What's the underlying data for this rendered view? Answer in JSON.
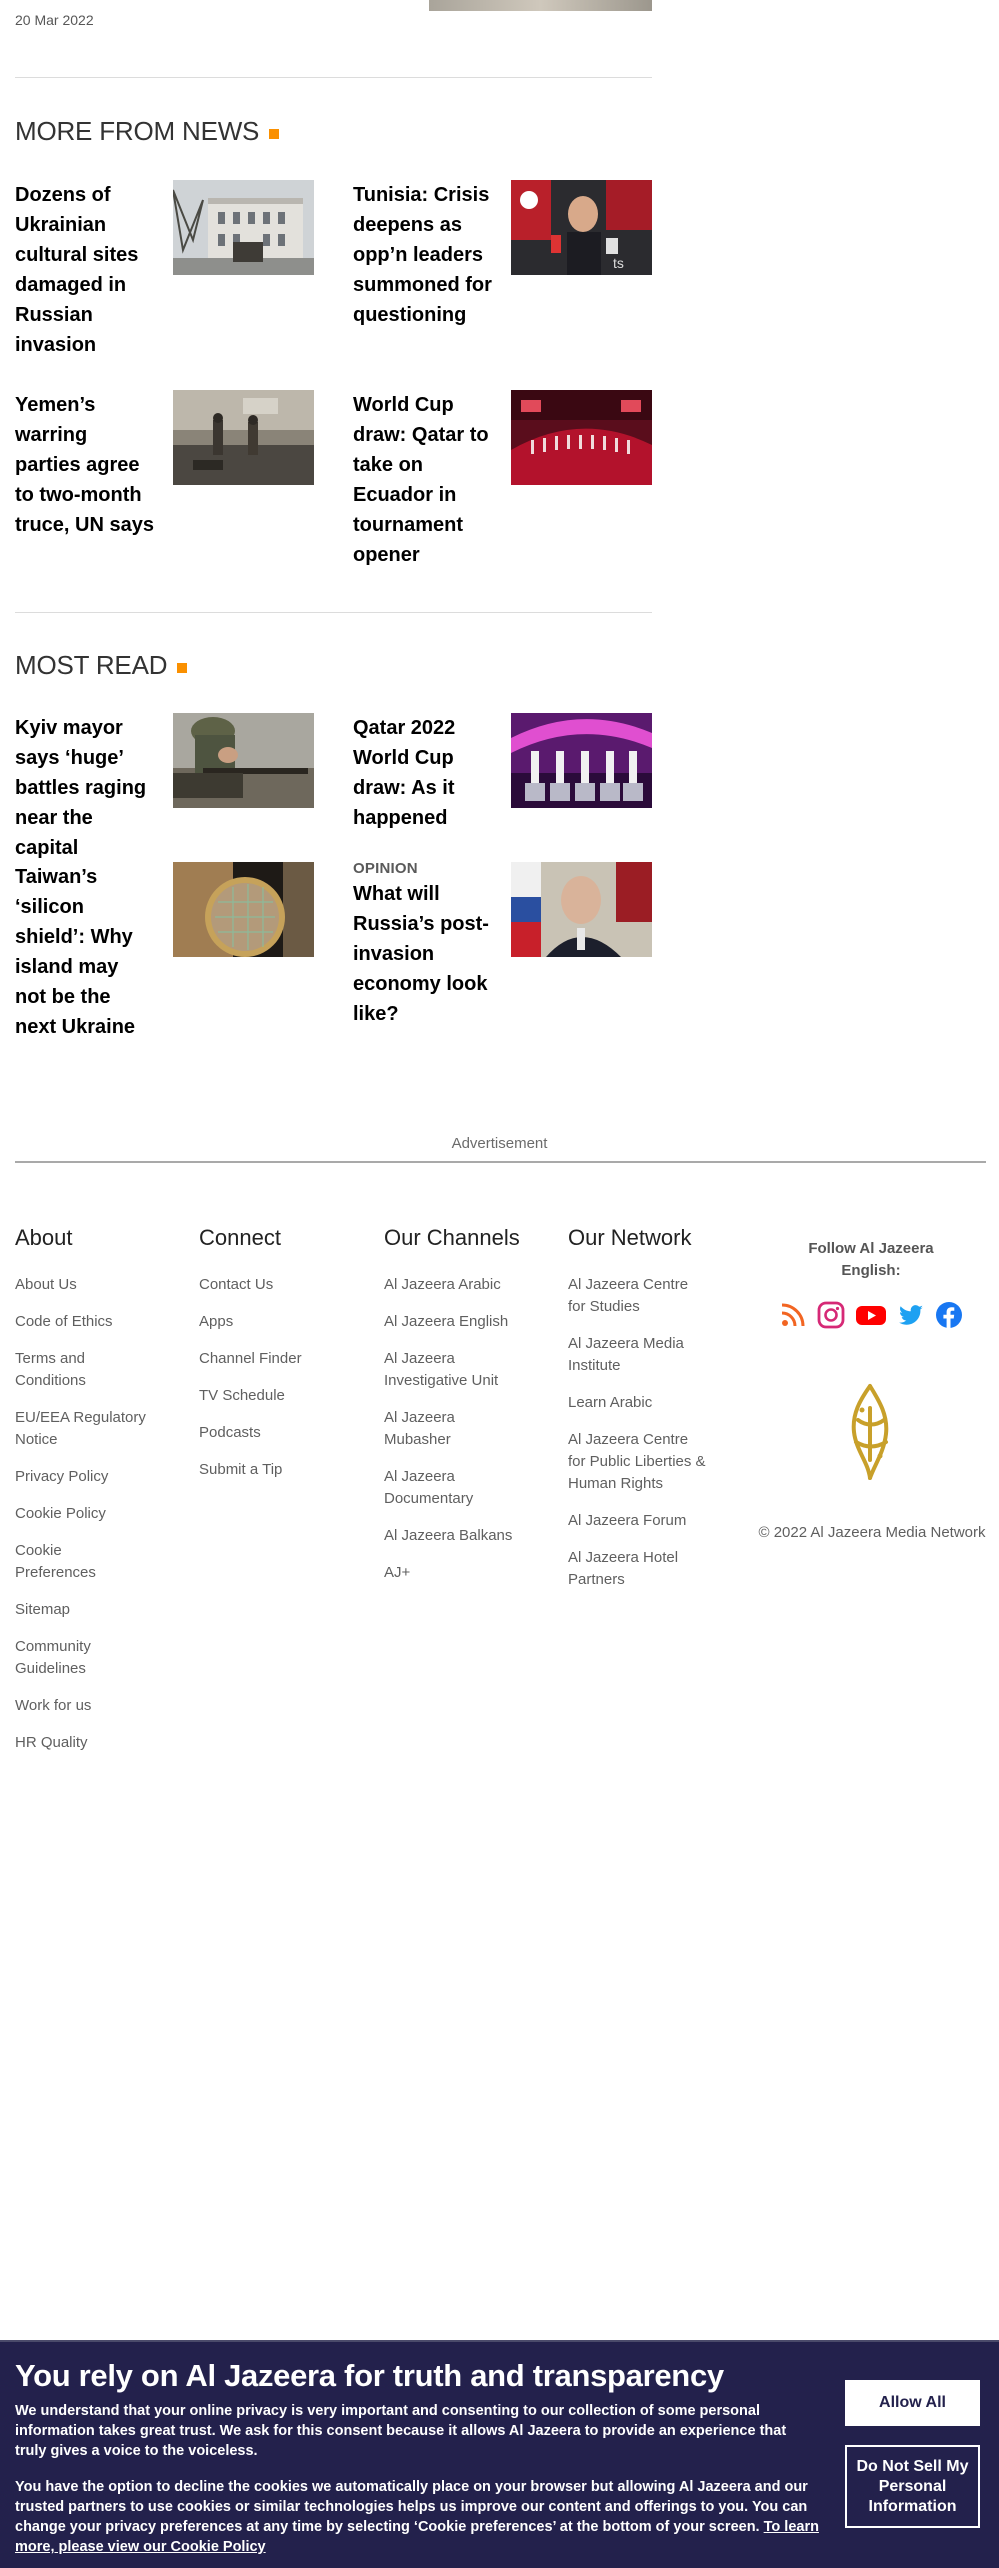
{
  "top": {
    "date": "20 Mar 2022"
  },
  "more_from_news": {
    "title": "MORE FROM NEWS",
    "items": [
      {
        "title": "Dozens of Ukrainian cultural sites damaged in Russian invasion"
      },
      {
        "title": "Tunisia: Crisis deepens as opp’n leaders summoned for questioning"
      },
      {
        "title": "Yemen’s warring parties agree to two-month truce, UN says"
      },
      {
        "title": "World Cup draw: Qatar to take on Ecuador in tournament opener"
      }
    ]
  },
  "most_read": {
    "title": "MOST READ",
    "items": [
      {
        "title": "Kyiv mayor says ‘huge’ battles raging near the capital"
      },
      {
        "title": "Qatar 2022 World Cup draw: As it happened"
      },
      {
        "title": "Taiwan’s ‘silicon shield’: Why island may not be the next Ukraine"
      },
      {
        "eyebrow": "OPINION",
        "title": "What will Russia’s post-invasion economy look like?"
      }
    ]
  },
  "advertisement_label": "Advertisement",
  "footer": {
    "about": {
      "heading": "About",
      "links": [
        "About Us",
        "Code of Ethics",
        "Terms and Conditions",
        "EU/EEA Regulatory Notice",
        "Privacy Policy",
        "Cookie Policy",
        "Cookie Preferences",
        "Sitemap",
        "Community Guidelines",
        "Work for us",
        "HR Quality"
      ]
    },
    "connect": {
      "heading": "Connect",
      "links": [
        "Contact Us",
        "Apps",
        "Channel Finder",
        "TV Schedule",
        "Podcasts",
        "Submit a Tip"
      ]
    },
    "channels": {
      "heading": "Our Channels",
      "links": [
        "Al Jazeera Arabic",
        "Al Jazeera English",
        "Al Jazeera Investigative Unit",
        "Al Jazeera Mubasher",
        "Al Jazeera Documentary",
        "Al Jazeera Balkans",
        "AJ+"
      ]
    },
    "network": {
      "heading": "Our Network",
      "links": [
        "Al Jazeera Centre for Studies",
        "Al Jazeera Media Institute",
        "Learn Arabic",
        "Al Jazeera Centre for Public Liberties & Human Rights",
        "Al Jazeera Forum",
        "Al Jazeera Hotel Partners"
      ]
    },
    "follow_label": "Follow Al Jazeera English:",
    "social_icons": [
      "rss-icon",
      "instagram-icon",
      "youtube-icon",
      "twitter-icon",
      "facebook-icon"
    ],
    "copyright": "© 2022 Al Jazeera Media Network"
  },
  "consent": {
    "heading": "You rely on Al Jazeera for truth and transparency",
    "para1": "We understand that your online privacy is very important and consenting to our collection of some personal information takes great trust. We ask for this consent because it allows Al Jazeera to provide an experience that truly gives a voice to the voiceless.",
    "para2": "You have the option to decline the cookies we automatically place on your browser but allowing Al Jazeera and our trusted partners to use cookies or similar technologies helps us improve our content and offerings to you. You can change your privacy preferences at any time by selecting ‘Cookie preferences’ at the bottom of your screen.",
    "link": "To learn more, please view our Cookie Policy",
    "allow_button": "Allow All",
    "dns_button": "Do Not Sell My Personal Information"
  },
  "colors": {
    "accent": "#fa9000",
    "banner_bg": "#23214c"
  }
}
